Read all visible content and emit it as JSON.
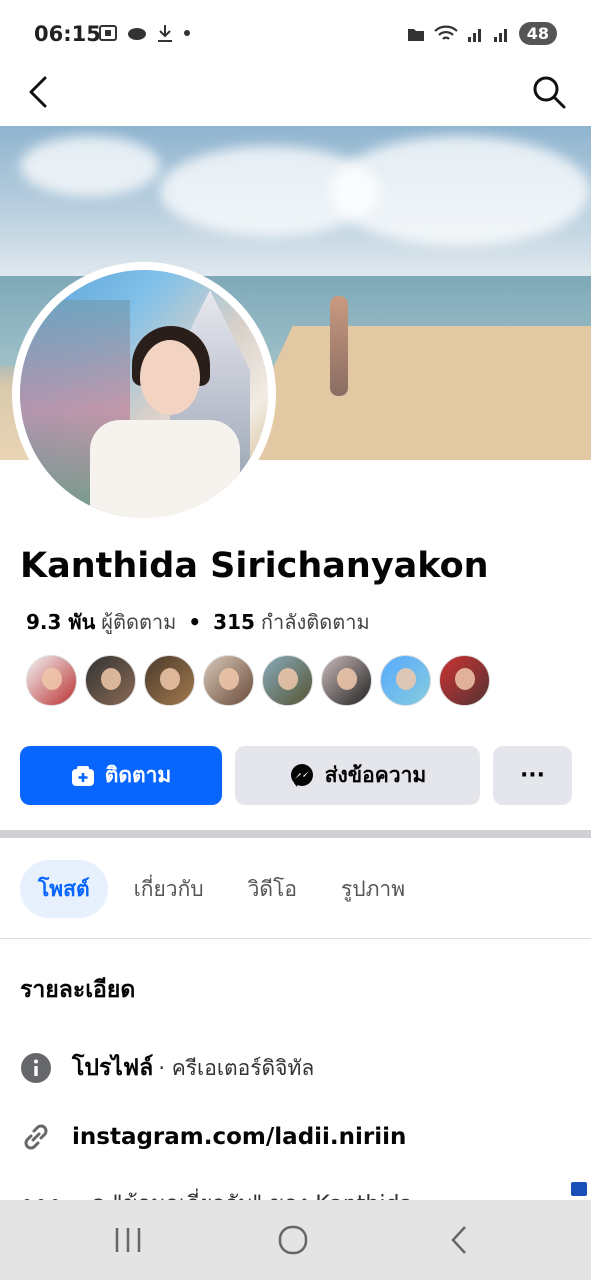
{
  "status_bar": {
    "time": "06:15",
    "battery": "48"
  },
  "app_bar": {
    "back_icon": "chevron-left-icon",
    "search_icon": "search-icon"
  },
  "profile": {
    "name": "Kanthida Sirichanyakon",
    "followers_count": "9.3 พัน",
    "followers_label": "ผู้ติดตาม",
    "following_count": "315",
    "following_label": "กำลังติดตาม",
    "mutual_friends_count": 8
  },
  "actions": {
    "follow_label": "ติดตาม",
    "message_label": "ส่งข้อความ",
    "more_label": "···"
  },
  "tabs": [
    {
      "label": "โพสต์",
      "active": true
    },
    {
      "label": "เกี่ยวกับ",
      "active": false
    },
    {
      "label": "วิดีโอ",
      "active": false
    },
    {
      "label": "รูปภาพ",
      "active": false
    }
  ],
  "details": {
    "title": "รายละเอียด",
    "profile_type_label": "โปรไฟล์",
    "profile_type_value": "· ครีเอเตอร์ดิจิทัล",
    "link": "instagram.com/ladii.niriin",
    "more_text": "ดู \"ข้อมูลเกี่ยวกับ\" ของ Kanthida"
  },
  "colors": {
    "brand_blue": "#0866ff",
    "button_gray": "#e4e6eb",
    "tab_active_bg": "#e7f0fd"
  }
}
